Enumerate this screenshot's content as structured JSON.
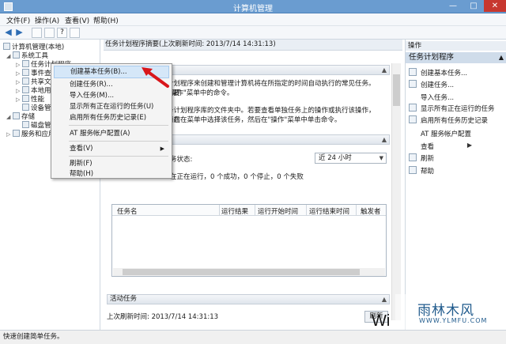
{
  "window": {
    "title": "计算机管理",
    "controls": {
      "minimize": "—",
      "maximize": "□",
      "close": "✕"
    }
  },
  "menubar": [
    "文件(F)",
    "操作(A)",
    "查看(V)",
    "帮助(H)"
  ],
  "toolbar": {
    "back": "◀",
    "forward": "▶",
    "help": "?"
  },
  "tree": {
    "root": "计算机管理(本地)",
    "system_tools": "系统工具",
    "task_scheduler": "任务计划程序",
    "event_viewer": "事件查看器",
    "shared_folders": "共享文件夹",
    "local_users": "本地用户和组",
    "performance": "性能",
    "device_manager": "设备管理器",
    "storage": "存储",
    "disk_management": "磁盘管理",
    "services": "服务和应用程序"
  },
  "center": {
    "header": "任务计划程序摘要(上次刷新时间: 2013/7/14 14:31:13)",
    "overview_line1": "计划程序来创建和管理计算机将在所指定的时间自动执行的常见任务。若要",
    "overview_line2": "\"操作\"菜单中的命令。",
    "overview_line3": "务计划程序库的文件夹中。若要查看单独任务上的操作或执行该操作，请在",
    "overview_line4": "务后在菜单中选择该任务，然后在\"操作\"菜单中单击命令。",
    "status_label": "务状态:",
    "filter_value": "近 24 小时",
    "summary": "在正在运行，0 个成功，0 个停止，0 个失败",
    "columns": [
      "任务名",
      "运行结果",
      "运行开始时间",
      "运行结束时间",
      "触发者"
    ],
    "active_tasks_title": "活动任务",
    "last_refresh": "上次刷新时间: 2013/7/14 14:31:13",
    "refresh_button": "刷新"
  },
  "actions": {
    "header": "操作",
    "subheader": "任务计划程序",
    "more": "▲",
    "items": [
      "创建基本任务...",
      "创建任务...",
      "导入任务...",
      "显示所有正在运行的任务",
      "启用所有任务历史记录",
      "AT 服务帐户配置",
      "查看",
      "刷新",
      "帮助"
    ]
  },
  "context_menu": {
    "items": [
      "创建基本任务(B)...",
      "创建任务(R)...",
      "导入任务(M)...",
      "显示所有正在运行的任务(U)",
      "启用所有任务历史记录(E)",
      "AT 服务帐户配置(A)",
      "查看(V)",
      "刷新(F)",
      "帮助(H)"
    ]
  },
  "status_bar": "快速创建简单任务。",
  "watermark": {
    "text": "雨林木风",
    "url": "WWW.YLMFU.COM",
    "overlay": "Wi"
  },
  "colors": {
    "titlebar": "#6a9cd0",
    "highlight": "#d5e7f8",
    "callout": "#d8161b",
    "accent": "#2e6db4"
  }
}
